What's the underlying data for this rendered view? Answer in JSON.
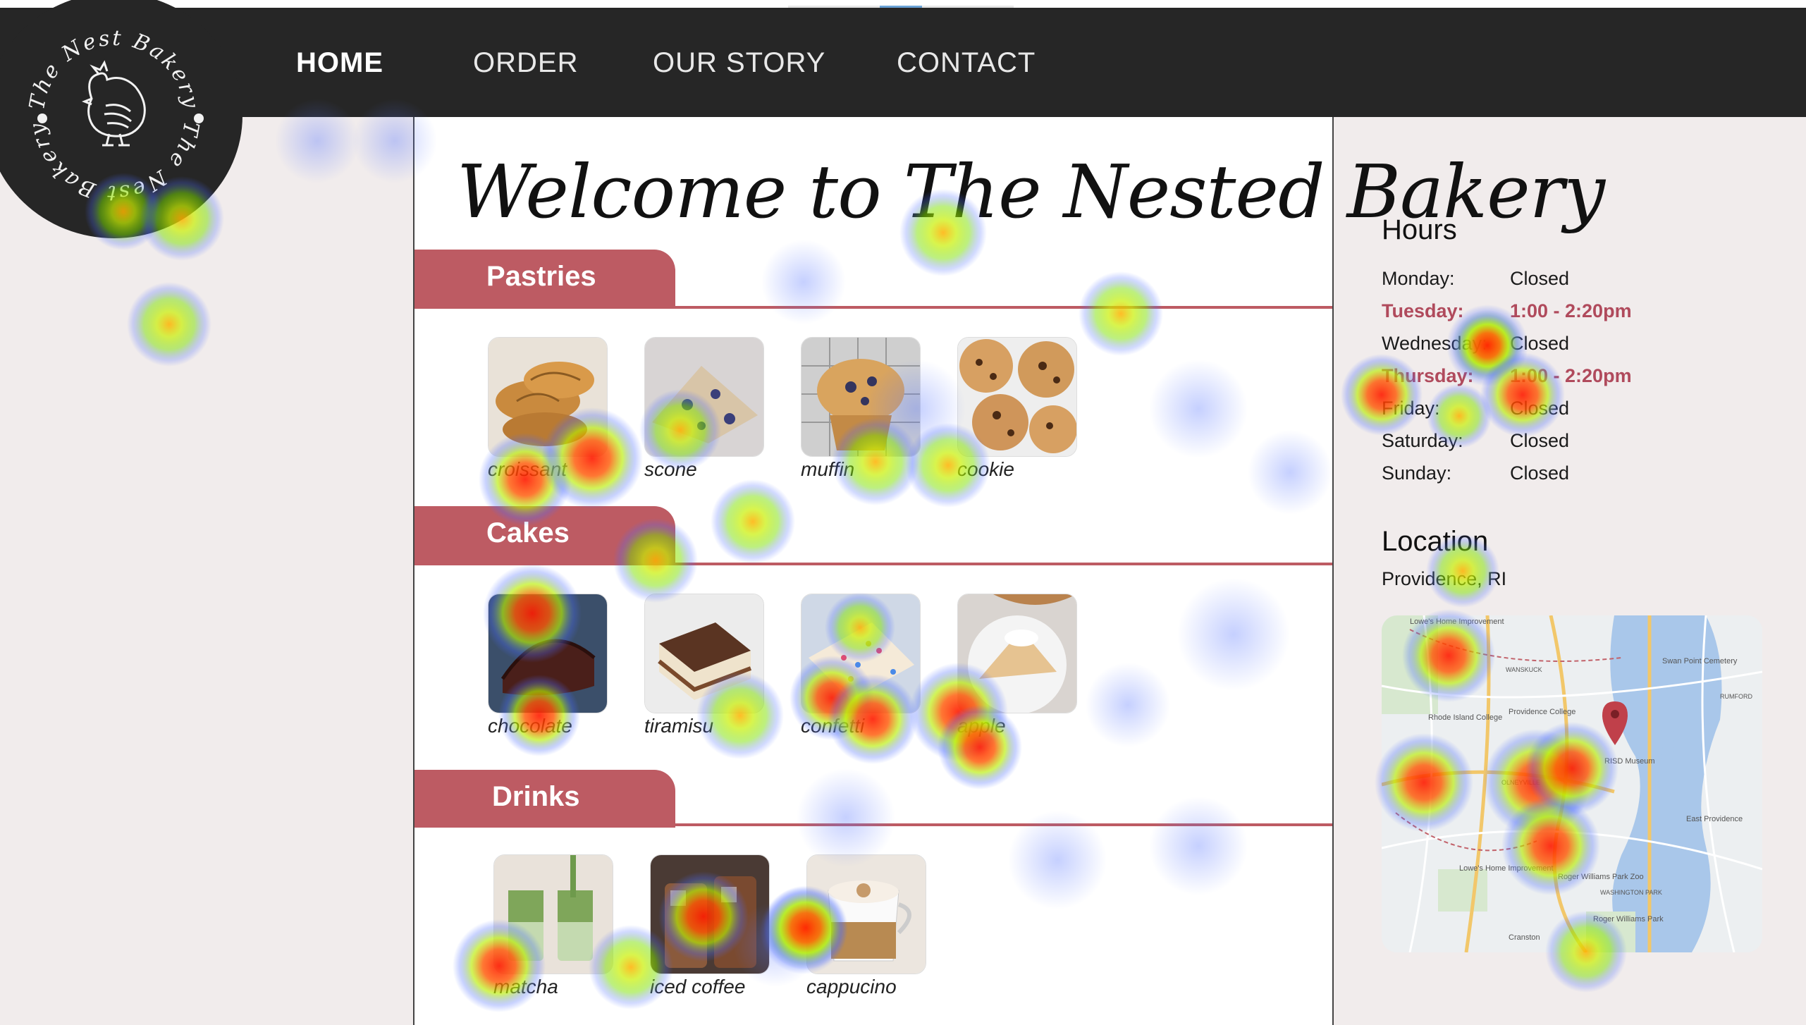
{
  "logo": {
    "ring_text": "The Nest Bakery"
  },
  "nav": {
    "items": [
      {
        "label": "HOME",
        "active": true
      },
      {
        "label": "ORDER",
        "active": false
      },
      {
        "label": "OUR STORY",
        "active": false
      },
      {
        "label": "CONTACT",
        "active": false
      }
    ]
  },
  "main": {
    "title": "Welcome to The Nested Bakery",
    "sections": [
      {
        "label": "Pastries",
        "items": [
          {
            "name": "croissant"
          },
          {
            "name": "scone"
          },
          {
            "name": "muffin"
          },
          {
            "name": "cookie"
          }
        ]
      },
      {
        "label": "Cakes",
        "items": [
          {
            "name": "chocolate"
          },
          {
            "name": "tiramisu"
          },
          {
            "name": "confetti"
          },
          {
            "name": "apple"
          }
        ]
      },
      {
        "label": "Drinks",
        "items": [
          {
            "name": "matcha"
          },
          {
            "name": "iced coffee"
          },
          {
            "name": "cappucino"
          }
        ]
      }
    ]
  },
  "hours": {
    "title": "Hours",
    "rows": [
      {
        "day": "Monday:",
        "time": "Closed",
        "highlight": false
      },
      {
        "day": "Tuesday:",
        "time": "1:00 - 2:20pm",
        "highlight": true
      },
      {
        "day": "Wednesday:",
        "time": "Closed",
        "highlight": false
      },
      {
        "day": "Thursday:",
        "time": "1:00 - 2:20pm",
        "highlight": true
      },
      {
        "day": "Friday:",
        "time": "Closed",
        "highlight": false
      },
      {
        "day": "Saturday:",
        "time": "Closed",
        "highlight": false
      },
      {
        "day": "Sunday:",
        "time": "Closed",
        "highlight": false
      }
    ]
  },
  "location": {
    "title": "Location",
    "city": "Providence, RI",
    "map_labels": [
      "Lowe's Home Improvement",
      "Rhode Island College",
      "Providence College",
      "Swan Point Cemetery",
      "RISD Museum",
      "East Providence",
      "Roger Williams Park",
      "Roger Williams Park Zoo",
      "Lowe's Home Improvement",
      "Cranston",
      "WANSKUCK",
      "RUMFORD",
      "OLNEYVILLE",
      "WASHINGTON PARK"
    ]
  },
  "colors": {
    "nav_bg": "#262626",
    "accent": "#bd5b63",
    "highlight_text": "#b04a5c",
    "page_bg": "#f1ecec"
  }
}
